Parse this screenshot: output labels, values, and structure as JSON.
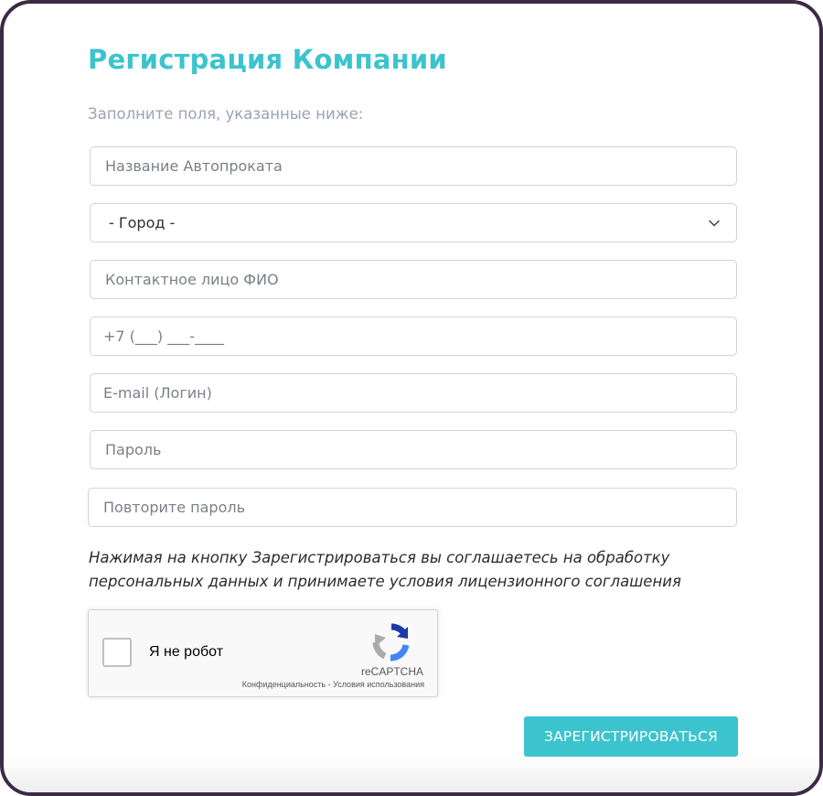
{
  "form": {
    "title": "Регистрация Компании",
    "subtitle": "Заполните поля, указанные ниже:",
    "fields": {
      "company_name": {
        "placeholder": "Название Автопроката",
        "value": ""
      },
      "city": {
        "selected": "- Город -"
      },
      "contact_person": {
        "placeholder": "Контактное лицо ФИО",
        "value": ""
      },
      "phone": {
        "placeholder": "+7 (___) ___-____",
        "value": ""
      },
      "email": {
        "placeholder": "E-mail (Логин)",
        "value": ""
      },
      "password": {
        "placeholder": "Пароль",
        "value": ""
      },
      "password_repeat": {
        "placeholder": "Повторите пароль",
        "value": ""
      }
    },
    "consent_text": "Нажимая на кнопку Зарегистрироваться вы соглашаетесь на обработку персональных данных и принимаете условия лицензионного соглашения",
    "captcha": {
      "label": "Я не робот",
      "brand": "reCAPTCHA",
      "privacy_link": "Конфиденциальность",
      "separator": " - ",
      "terms_link": "Условия использования",
      "checked": false
    },
    "submit_label": "ЗАРЕГИСТРИРОВАТЬСЯ"
  },
  "colors": {
    "accent": "#3cc4ce",
    "frame_border": "#3d2a45",
    "subtitle_text": "#9aa3b5",
    "field_border": "#cfd3dc"
  },
  "icons": {
    "select_arrow": "chevron-down-icon",
    "captcha_logo": "recaptcha-logo-icon"
  }
}
